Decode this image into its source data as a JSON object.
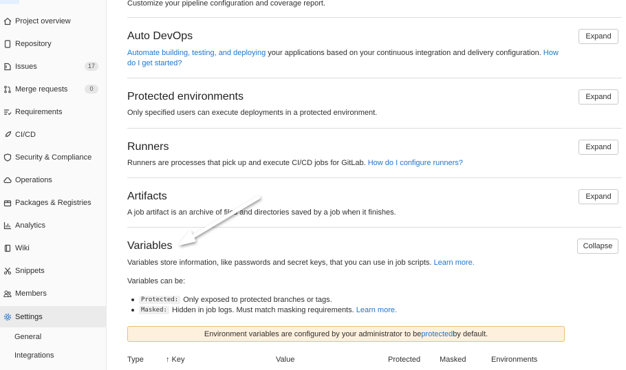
{
  "sidebar": {
    "items": [
      {
        "label": "Project overview",
        "icon": "home-icon"
      },
      {
        "label": "Repository",
        "icon": "doc-icon"
      },
      {
        "label": "Issues",
        "icon": "issues-icon",
        "count": "17"
      },
      {
        "label": "Merge requests",
        "icon": "merge-request-icon",
        "count": "0"
      },
      {
        "label": "Requirements",
        "icon": "requirements-icon"
      },
      {
        "label": "CI/CD",
        "icon": "rocket-icon"
      },
      {
        "label": "Security & Compliance",
        "icon": "shield-icon"
      },
      {
        "label": "Operations",
        "icon": "cloud-gear-icon"
      },
      {
        "label": "Packages & Registries",
        "icon": "package-icon"
      },
      {
        "label": "Analytics",
        "icon": "chart-icon"
      },
      {
        "label": "Wiki",
        "icon": "book-icon"
      },
      {
        "label": "Snippets",
        "icon": "scissors-icon"
      },
      {
        "label": "Members",
        "icon": "users-icon"
      },
      {
        "label": "Settings",
        "icon": "gear-icon"
      }
    ],
    "sub_items": [
      "General",
      "Integrations"
    ]
  },
  "main": {
    "top_text": "Customize your pipeline configuration and coverage report.",
    "sections": {
      "autodevops": {
        "title": "Auto DevOps",
        "desc_link": "Automate building, testing, and deploying",
        "desc_text": " your applications based on your continuous integration and delivery configuration. ",
        "desc_link2": "How do I get started?",
        "button": "Expand"
      },
      "protected": {
        "title": "Protected environments",
        "desc": "Only specified users can execute deployments in a protected environment.",
        "button": "Expand"
      },
      "runners": {
        "title": "Runners",
        "desc": "Runners are processes that pick up and execute CI/CD jobs for GitLab. ",
        "desc_link": "How do I configure runners?",
        "button": "Expand"
      },
      "artifacts": {
        "title": "Artifacts",
        "desc": "A job artifact is an archive of files and directories saved by a job when it finishes.",
        "button": "Expand"
      },
      "variables": {
        "title": "Variables",
        "desc": "Variables store information, like passwords and secret keys, that you can use in job scripts. ",
        "desc_link": "Learn more.",
        "button": "Collapse",
        "can_be": "Variables can be:",
        "bullet1_code": "Protected:",
        "bullet1_text": "Only exposed to protected branches or tags.",
        "bullet2_code": "Masked:",
        "bullet2_text": "Hidden in job logs. Must match masking requirements. ",
        "bullet2_link": "Learn more.",
        "alert_pre": "Environment variables are configured by your administrator to be ",
        "alert_link": "protected",
        "alert_post": " by default.",
        "table_headers": [
          "Type",
          "↑ Key",
          "Value",
          "Protected",
          "Masked",
          "Environments"
        ]
      }
    }
  },
  "colors": {
    "link": "#1f75cb",
    "alert_bg": "#fdf1dd",
    "alert_border": "#e9be74"
  }
}
